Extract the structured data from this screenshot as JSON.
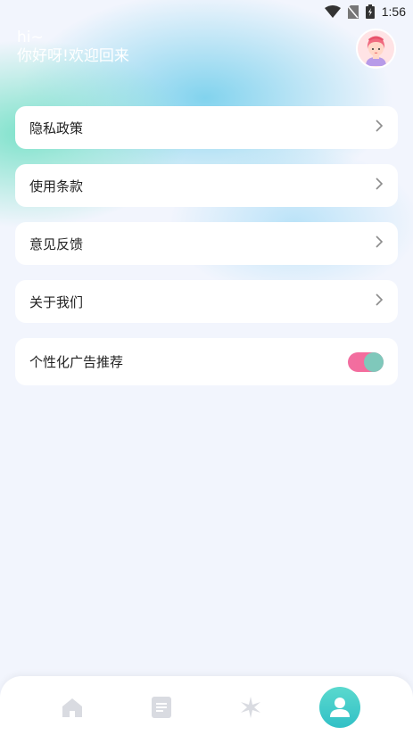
{
  "status_bar": {
    "time": "1:56"
  },
  "header": {
    "greeting_line1": "hi~",
    "greeting_line2": "你好呀!欢迎回来"
  },
  "menu": {
    "items": [
      {
        "label": "隐私政策"
      },
      {
        "label": "使用条款"
      },
      {
        "label": "意见反馈"
      },
      {
        "label": "关于我们"
      }
    ],
    "toggle_item": {
      "label": "个性化广告推荐",
      "enabled": true
    }
  },
  "tabbar": {
    "tabs": [
      {
        "icon": "home-icon",
        "active": false
      },
      {
        "icon": "document-icon",
        "active": false
      },
      {
        "icon": "sparkle-icon",
        "active": false
      },
      {
        "icon": "user-icon",
        "active": true
      }
    ]
  },
  "colors": {
    "toggle_track": "#f26ea0",
    "toggle_knob": "#7fc8bb",
    "active_tab": "#3ccac9",
    "inactive_tab_icon": "#d9dbe1"
  }
}
